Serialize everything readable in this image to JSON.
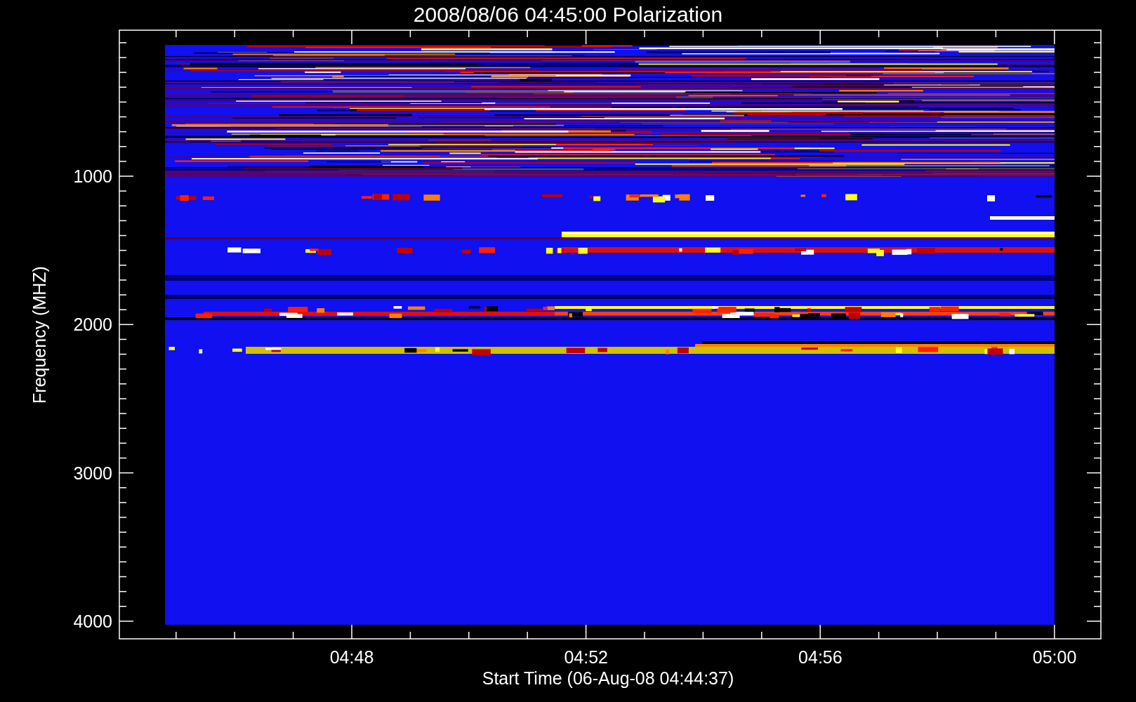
{
  "title": "2008/08/06 04:45:00 Polarization",
  "y_axis": {
    "label": "Frequency (MHZ)",
    "ticks": [
      "1000",
      "2000",
      "3000",
      "4000"
    ]
  },
  "x_axis": {
    "label": "Start Time (06-Aug-08 04:44:37)",
    "ticks": [
      "04:48",
      "04:52",
      "04:56",
      "05:00"
    ]
  }
}
